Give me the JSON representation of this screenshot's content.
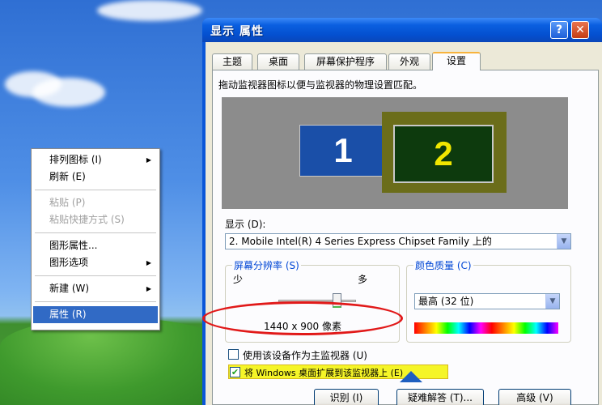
{
  "context_menu": {
    "items": [
      {
        "label": "排列图标 (I)",
        "submenu": true,
        "state": "normal"
      },
      {
        "label": "刷新 (E)",
        "submenu": false,
        "state": "normal"
      },
      {
        "label": "粘贴 (P)",
        "submenu": false,
        "state": "disabled"
      },
      {
        "label": "粘贴快捷方式 (S)",
        "submenu": false,
        "state": "disabled"
      },
      {
        "label": "图形属性...",
        "submenu": false,
        "state": "normal"
      },
      {
        "label": "图形选项",
        "submenu": true,
        "state": "normal"
      },
      {
        "label": "新建 (W)",
        "submenu": true,
        "state": "normal"
      },
      {
        "label": "属性 (R)",
        "submenu": false,
        "state": "selected"
      }
    ]
  },
  "window": {
    "title": "显示 属性",
    "help_label": "?",
    "close_label": "✕"
  },
  "tabs": [
    {
      "label": "主题"
    },
    {
      "label": "桌面"
    },
    {
      "label": "屏幕保护程序"
    },
    {
      "label": "外观"
    },
    {
      "label": "设置"
    }
  ],
  "settings": {
    "instruction": "拖动监视器图标以便与监视器的物理设置匹配。",
    "monitor1": "1",
    "monitor2": "2",
    "display_label": "显示 (D):",
    "display_value": "2. Mobile Intel(R) 4 Series Express Chipset Family 上的",
    "resolution_group": "屏幕分辨率 (S)",
    "less": "少",
    "more": "多",
    "resolution_level": 0.75,
    "resolution_value": "1440 x 900 像素",
    "color_group": "颜色质量 (C)",
    "color_value": "最高 (32 位)",
    "primary_checkbox": "使用该设备作为主监视器 (U)",
    "extend_checkbox": "将 Windows 桌面扩展到该监视器上 (E)"
  },
  "buttons": {
    "identify": "识别 (I)",
    "troubleshoot": "疑难解答 (T)...",
    "advanced": "高级 (V)"
  },
  "colors": {
    "title_bar": "#0a5fe0",
    "selection": "#316ac5",
    "annotation": "#e11919",
    "highlight": "#f5f528"
  }
}
